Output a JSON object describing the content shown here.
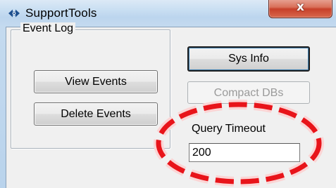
{
  "window": {
    "title": "SupportTools",
    "close_glyph": "x",
    "icon": "supporttools-app-icon"
  },
  "event_log": {
    "group_label": "Event Log",
    "view_events_label": "View Events",
    "delete_events_label": "Delete Events"
  },
  "actions": {
    "sys_info_label": "Sys Info",
    "compact_dbs_label": "Compact DBs",
    "compact_dbs_enabled": false
  },
  "query_timeout": {
    "label": "Query Timeout",
    "value": "200"
  },
  "annotation": {
    "shape": "dashed-ellipse",
    "color": "#e8141a"
  }
}
